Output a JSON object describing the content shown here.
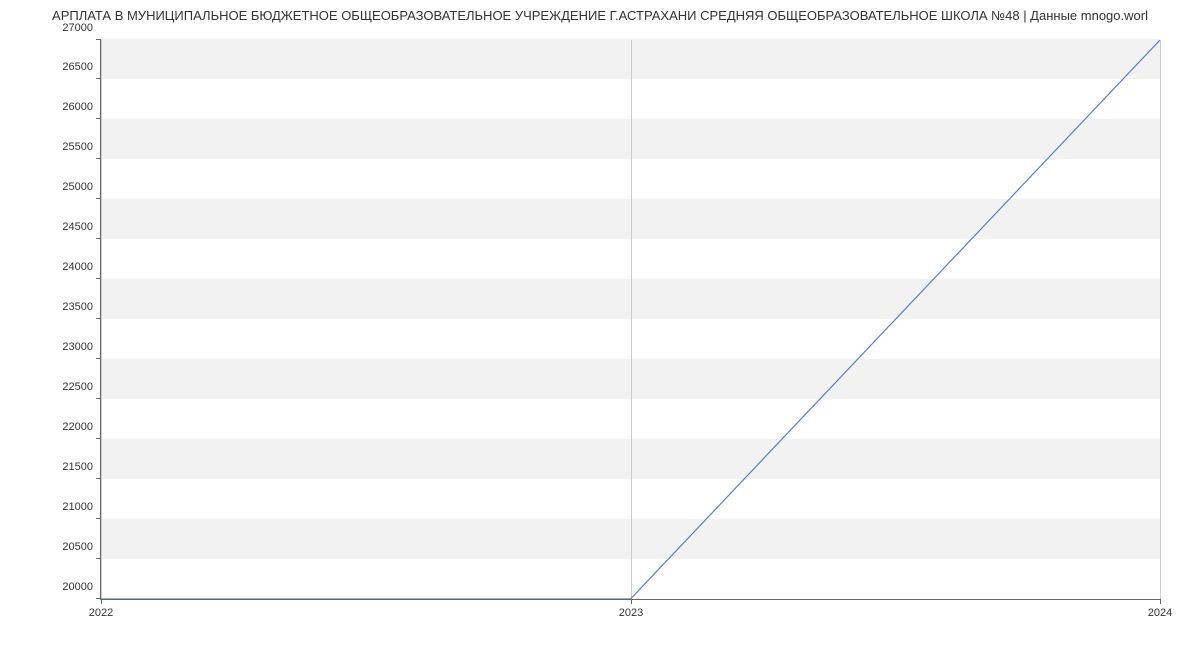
{
  "chart_data": {
    "type": "line",
    "title": "АРПЛАТА В МУНИЦИПАЛЬНОЕ БЮДЖЕТНОЕ ОБЩЕОБРАЗОВАТЕЛЬНОЕ УЧРЕЖДЕНИЕ Г.АСТРАХАНИ СРЕДНЯЯ ОБЩЕОБРАЗОВАТЕЛЬНОЕ ШКОЛА №48 | Данные mnogo.worl",
    "x": [
      "2022",
      "2023",
      "2024"
    ],
    "values": [
      20000,
      20000,
      27000
    ],
    "xlabel": "",
    "ylabel": "",
    "ylim": [
      20000,
      27000
    ],
    "y_ticks": [
      20000,
      20500,
      21000,
      21500,
      22000,
      22500,
      23000,
      23500,
      24000,
      24500,
      25000,
      25500,
      26000,
      26500,
      27000
    ],
    "x_ticks": [
      "2022",
      "2023",
      "2024"
    ],
    "line_color": "#5b7fc7"
  }
}
